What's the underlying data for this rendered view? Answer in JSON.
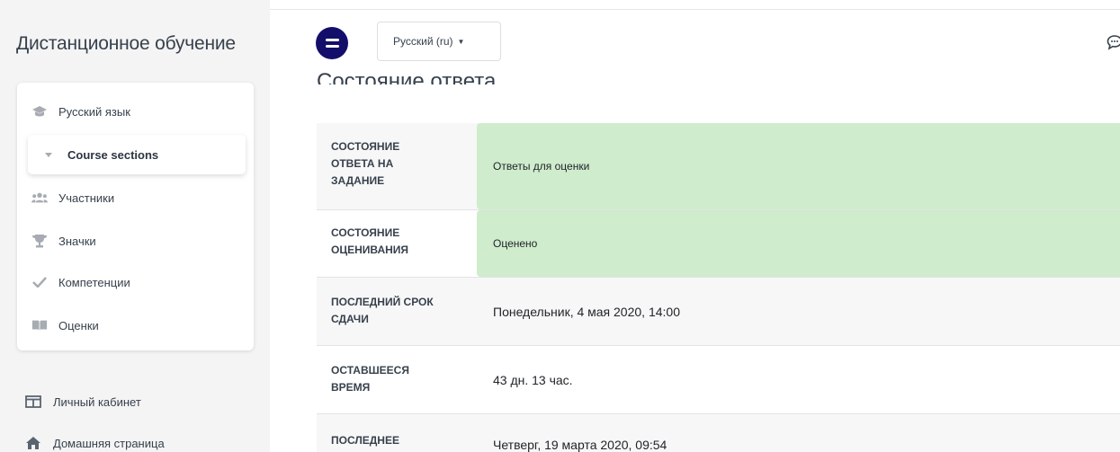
{
  "sidebar": {
    "brand": "Дистанционное обучение",
    "items": [
      {
        "label": "Русский язык",
        "icon": "graduation-cap-icon"
      },
      {
        "label": "Course sections",
        "icon": "caret-down-icon"
      },
      {
        "label": "Участники",
        "icon": "users-icon"
      },
      {
        "label": "Значки",
        "icon": "trophy-icon"
      },
      {
        "label": "Компетенции",
        "icon": "check-icon"
      },
      {
        "label": "Оценки",
        "icon": "book-icon"
      }
    ],
    "footer": [
      {
        "label": "Личный кабинет",
        "icon": "dashboard-icon"
      },
      {
        "label": "Домашняя страница",
        "icon": "home-icon"
      }
    ]
  },
  "header": {
    "language": "Русский (ru)",
    "menu_icon": "hamburger-icon",
    "chat_icon": "chat-icon"
  },
  "main": {
    "heading": "Состояние ответа",
    "rows": [
      {
        "label": "Состояние ответа на задание",
        "value": "Ответы для оценки",
        "status": "green"
      },
      {
        "label": "Состояние оценивания",
        "value": "Оценено",
        "status": "green"
      },
      {
        "label": "Последний срок сдачи",
        "value": "Понедельник, 4 мая 2020, 14:00",
        "status": "plain"
      },
      {
        "label": "Оставшееся время",
        "value": "43 дн. 13 час.",
        "status": "plain"
      },
      {
        "label": "Последнее",
        "value": "Четверг, 19 марта 2020, 09:54",
        "status": "plain"
      }
    ]
  },
  "colors": {
    "accent": "#140e6b",
    "success_bg": "#cfeccd",
    "sidebar_bg": "#f4f4f4"
  }
}
